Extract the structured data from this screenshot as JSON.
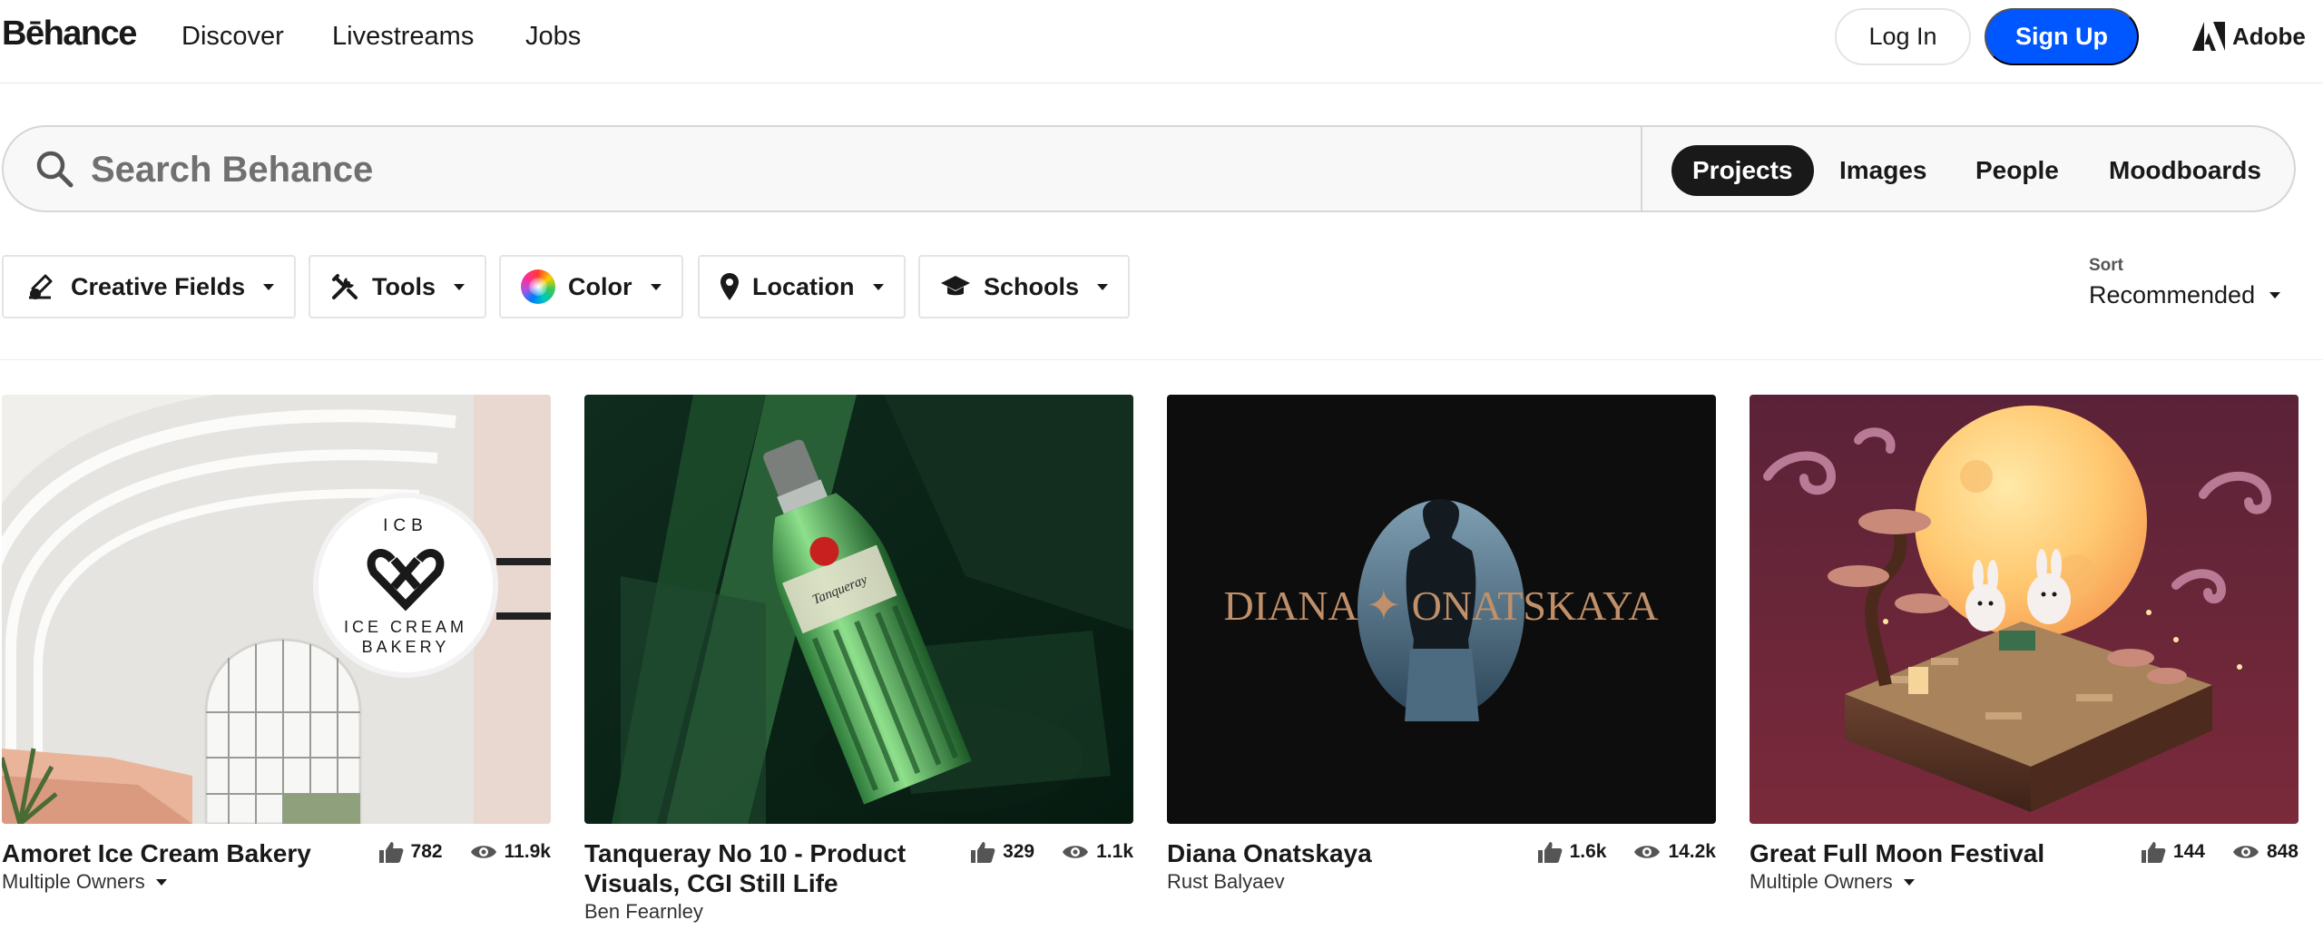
{
  "header": {
    "logo": "Bēhance",
    "nav": [
      "Discover",
      "Livestreams",
      "Jobs"
    ],
    "login_label": "Log In",
    "signup_label": "Sign Up",
    "adobe_label": "Adobe"
  },
  "search": {
    "placeholder": "Search Behance",
    "scopes": [
      "Projects",
      "Images",
      "People",
      "Moodboards"
    ],
    "active_scope": "Projects"
  },
  "filters": [
    "Creative Fields",
    "Tools",
    "Color",
    "Location",
    "Schools"
  ],
  "sort": {
    "label": "Sort",
    "value": "Recommended"
  },
  "projects": [
    {
      "title": "Amoret Ice Cream Bakery",
      "owner": "Multiple Owners",
      "owner_dropdown": true,
      "likes": "782",
      "views": "11.9k",
      "badge_top": "ICB",
      "badge_bottom": "ICE CREAM BAKERY"
    },
    {
      "title": "Tanqueray No 10 - Product Visuals, CGI Still Life",
      "owner": "Ben Fearnley",
      "owner_dropdown": false,
      "likes": "329",
      "views": "1.1k"
    },
    {
      "title": "Diana Onatskaya",
      "owner": "Rust Balyaev",
      "owner_dropdown": false,
      "likes": "1.6k",
      "views": "14.2k",
      "art_text": "DIANA ✦ ONATSKAYA"
    },
    {
      "title": "Great Full Moon Festival",
      "owner": "Multiple Owners",
      "owner_dropdown": true,
      "likes": "144",
      "views": "848"
    }
  ],
  "colors": {
    "accent": "#0057ff",
    "text": "#191919",
    "active_scope_bg": "#191919"
  },
  "icons": [
    "search-icon",
    "creative-fields-icon",
    "tools-icon",
    "color-wheel-icon",
    "location-pin-icon",
    "graduation-cap-icon",
    "thumbs-up-icon",
    "eye-icon",
    "adobe-logo-icon"
  ]
}
